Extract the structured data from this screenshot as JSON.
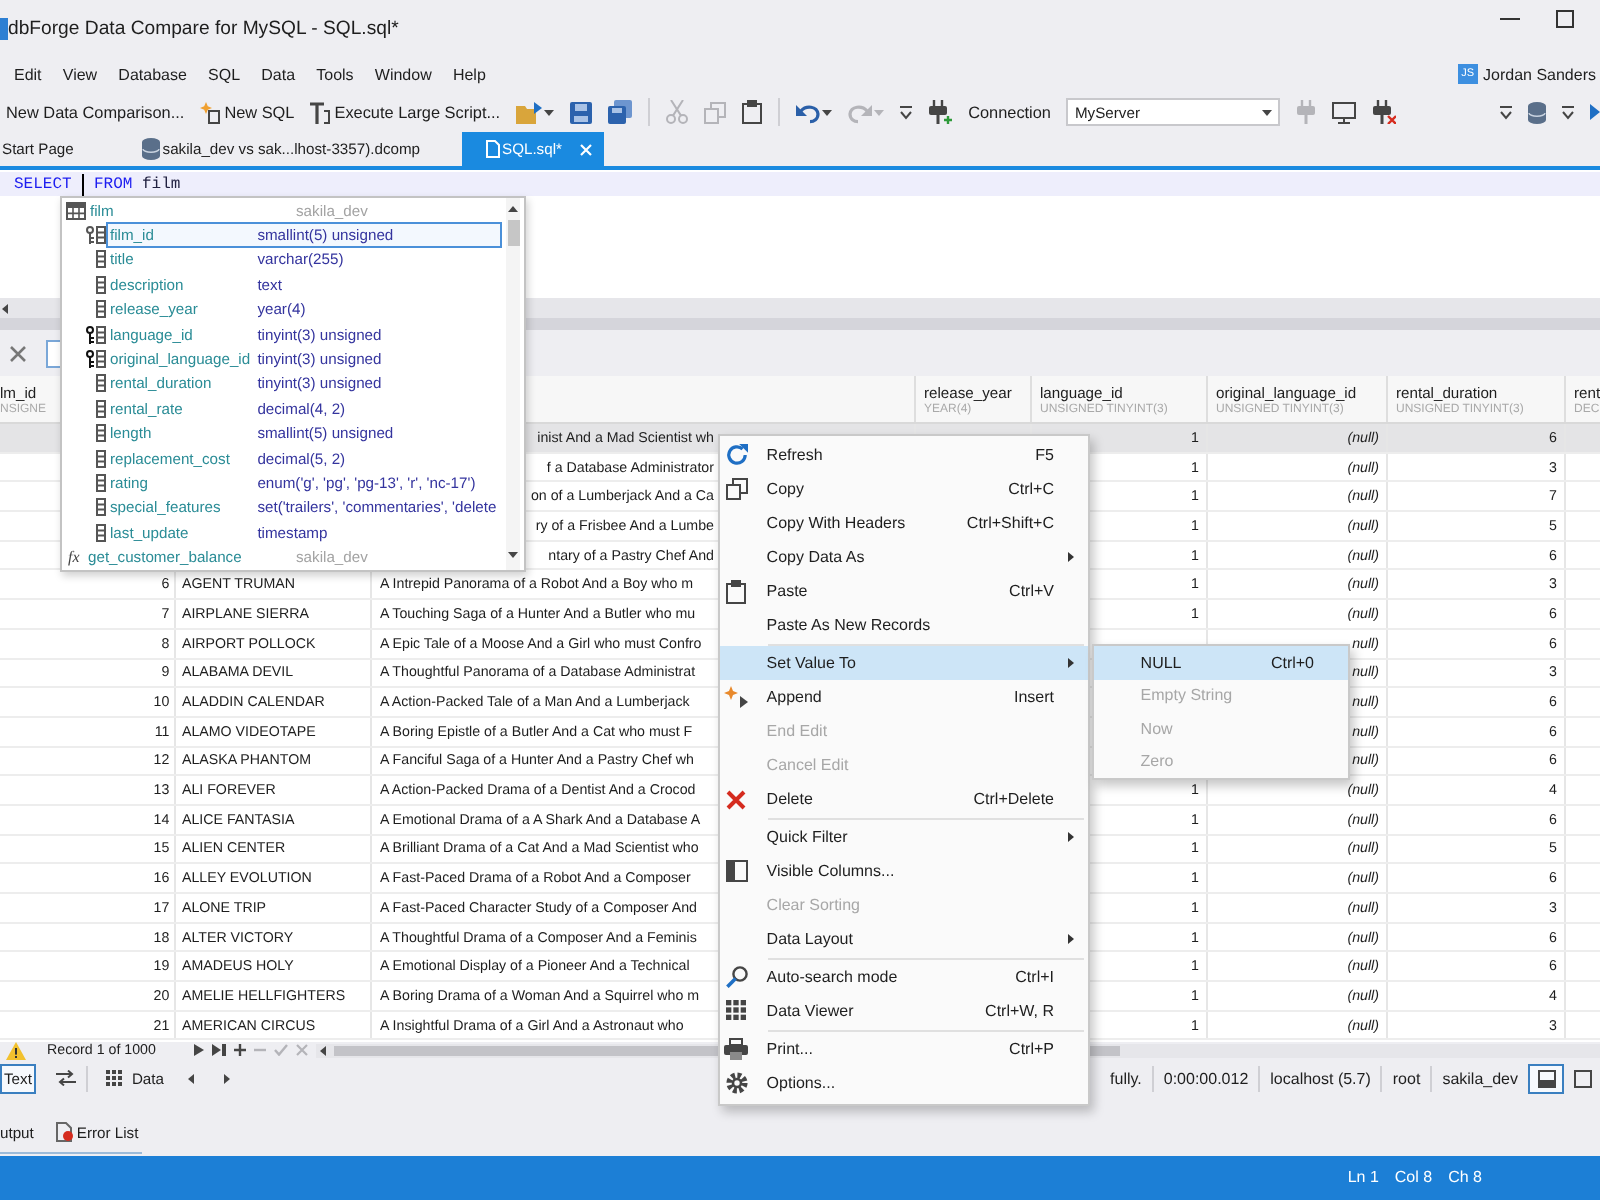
{
  "window": {
    "title": "dbForge Data Compare for MySQL - SQL.sql*"
  },
  "menu_bar": {
    "items": [
      "Edit",
      "View",
      "Database",
      "SQL",
      "Data",
      "Tools",
      "Window",
      "Help"
    ],
    "user": {
      "initials": "JS",
      "name": "Jordan Sanders"
    }
  },
  "toolbar": {
    "buttons": [
      "New Data Comparison...",
      "New SQL",
      "Execute Large Script..."
    ],
    "tools": [
      {
        "disabled": false
      },
      {
        "disabled": false
      },
      {
        "disabled": false
      },
      {
        "disabled": true
      },
      {
        "disabled": true
      },
      {
        "disabled": false
      },
      {
        "disabled": false
      },
      {
        "disabled": true
      }
    ],
    "connection": {
      "label": "Connection",
      "value": "MyServer"
    },
    "connection_tools": [
      {
        "disabled": false
      },
      {
        "disabled": true
      },
      {
        "disabled": false
      },
      {
        "disabled": false
      }
    ]
  },
  "document_tabs": [
    {
      "label": "Start Page",
      "selected": false
    },
    {
      "label": "sakila_dev vs sak...lhost-3357).dcomp",
      "selected": false
    },
    {
      "label": "SQL.sql*",
      "selected": true
    }
  ],
  "editor": {
    "tokens": [
      {
        "kind": "keyword",
        "text": "SELECT"
      },
      {
        "kind": "caret"
      },
      {
        "kind": "keyword",
        "text": "FROM"
      },
      {
        "kind": "identifier",
        "text": "film"
      }
    ]
  },
  "autocomplete": {
    "table": "film",
    "schema": "sakila_dev",
    "items": [
      {
        "kind": "primary_key",
        "name": "film_id",
        "detail": "smallint(5) unsigned",
        "selected": true
      },
      {
        "kind": "column",
        "name": "title",
        "detail": "varchar(255)",
        "selected": false
      },
      {
        "kind": "column",
        "name": "description",
        "detail": "text",
        "selected": false
      },
      {
        "kind": "column",
        "name": "release_year",
        "detail": "year(4)",
        "selected": false
      },
      {
        "kind": "foreign_key",
        "name": "language_id",
        "detail": "tinyint(3) unsigned",
        "selected": false
      },
      {
        "kind": "foreign_key",
        "name": "original_language_id",
        "detail": "tinyint(3) unsigned",
        "selected": false
      },
      {
        "kind": "column",
        "name": "rental_duration",
        "detail": "tinyint(3) unsigned",
        "selected": false
      },
      {
        "kind": "column",
        "name": "rental_rate",
        "detail": "decimal(4, 2)",
        "selected": false
      },
      {
        "kind": "column",
        "name": "length",
        "detail": "smallint(5) unsigned",
        "selected": false
      },
      {
        "kind": "column",
        "name": "replacement_cost",
        "detail": "decimal(5, 2)",
        "selected": false
      },
      {
        "kind": "column",
        "name": "rating",
        "detail": "enum('g', 'pg', 'pg-13', 'r', 'nc-17')",
        "selected": false
      },
      {
        "kind": "column",
        "name": "special_features",
        "detail": "set('trailers', 'commentaries', 'delete",
        "selected": false
      },
      {
        "kind": "column",
        "name": "last_update",
        "detail": "timestamp",
        "selected": false
      },
      {
        "kind": "function",
        "symbol": "fx",
        "name": "get_customer_balance",
        "detail": "sakila_dev",
        "selected": false
      }
    ]
  },
  "grid": {
    "columns": {
      "column_1": {
        "name": "lm_id",
        "type": "NSIGNE"
      },
      "column_4": {
        "name": "release_year",
        "type": "YEAR(4)"
      },
      "column_5": {
        "name": "language_id",
        "type": "UNSIGNED TINYINT(3)"
      },
      "column_6": {
        "name": "original_language_id",
        "type": "UNSIGNED TINYINT(3)"
      },
      "column_7": {
        "name": "rental_duration",
        "type": "UNSIGNED TINYINT(3)"
      },
      "column_8": {
        "name": "rent",
        "type": "DEC"
      }
    },
    "rows": [
      {
        "selected": true,
        "column_3": "inist And a Mad Scientist wh",
        "column_5": "1",
        "column_6": "(null)",
        "column_7": "6"
      },
      {
        "selected": false,
        "column_3": "f a Database Administrator",
        "column_5": "1",
        "column_6": "(null)",
        "column_7": "3"
      },
      {
        "selected": false,
        "column_3": "on of a Lumberjack And a Ca",
        "column_5": "1",
        "column_6": "(null)",
        "column_7": "7"
      },
      {
        "selected": false,
        "column_3": "ry of a Frisbee And a Lumbe",
        "column_5": "1",
        "column_6": "(null)",
        "column_7": "5"
      },
      {
        "selected": false,
        "column_3": "ntary of a Pastry Chef And",
        "column_5": "1",
        "column_6": "(null)",
        "column_7": "6"
      },
      {
        "selected": false,
        "column_1": "6",
        "column_2": "AGENT TRUMAN",
        "column_3": "A Intrepid Panorama of a Robot And a Boy who m",
        "column_5": "1",
        "column_6": "(null)",
        "column_7": "3"
      },
      {
        "selected": false,
        "column_1": "7",
        "column_2": "AIRPLANE SIERRA",
        "column_3": "A Touching Saga of a Hunter And a Butler who mu",
        "column_5": "1",
        "column_6": "(null)",
        "column_7": "6"
      },
      {
        "selected": false,
        "column_1": "8",
        "column_2": "AIRPORT POLLOCK",
        "column_3": "A Epic Tale of a Moose And a Girl who must Confro",
        "column_6": "null)",
        "column_7": "6"
      },
      {
        "selected": false,
        "column_1": "9",
        "column_2": "ALABAMA DEVIL",
        "column_3": "A Thoughtful Panorama of a Database Administrat",
        "column_6": "null)",
        "column_7": "3"
      },
      {
        "selected": false,
        "column_1": "10",
        "column_2": "ALADDIN CALENDAR",
        "column_3": "A Action-Packed Tale of a Man And a Lumberjack",
        "column_6": "null)",
        "column_7": "6"
      },
      {
        "selected": false,
        "column_1": "11",
        "column_2": "ALAMO VIDEOTAPE",
        "column_3": "A Boring Epistle of a Butler And a Cat who must F",
        "column_6": "null)",
        "column_7": "6"
      },
      {
        "selected": false,
        "column_1": "12",
        "column_2": "ALASKA PHANTOM",
        "column_3": "A Fanciful Saga of a Hunter And a Pastry Chef wh",
        "column_6": "null)",
        "column_7": "6"
      },
      {
        "selected": false,
        "column_1": "13",
        "column_2": "ALI FOREVER",
        "column_3": "A Action-Packed Drama of a Dentist And a Crocod",
        "column_5": "1",
        "column_6": "(null)",
        "column_7": "4"
      },
      {
        "selected": false,
        "column_1": "14",
        "column_2": "ALICE FANTASIA",
        "column_3": "A Emotional Drama of a A Shark And a Database A",
        "column_5": "1",
        "column_6": "(null)",
        "column_7": "6"
      },
      {
        "selected": false,
        "column_1": "15",
        "column_2": "ALIEN CENTER",
        "column_3": "A Brilliant Drama of a Cat And a Mad Scientist who",
        "column_5": "1",
        "column_6": "(null)",
        "column_7": "5"
      },
      {
        "selected": false,
        "column_1": "16",
        "column_2": "ALLEY EVOLUTION",
        "column_3": "A Fast-Paced Drama of a Robot And a Composer",
        "column_5": "1",
        "column_6": "(null)",
        "column_7": "6"
      },
      {
        "selected": false,
        "column_1": "17",
        "column_2": "ALONE TRIP",
        "column_3": "A Fast-Paced Character Study of a Composer And",
        "column_5": "1",
        "column_6": "(null)",
        "column_7": "3"
      },
      {
        "selected": false,
        "column_1": "18",
        "column_2": "ALTER VICTORY",
        "column_3": "A Thoughtful Drama of a Composer And a Feminis",
        "column_5": "1",
        "column_6": "(null)",
        "column_7": "6"
      },
      {
        "selected": false,
        "column_1": "19",
        "column_2": "AMADEUS HOLY",
        "column_3": "A Emotional Display of a Pioneer And a Technical",
        "column_5": "1",
        "column_6": "(null)",
        "column_7": "6"
      },
      {
        "selected": false,
        "column_1": "20",
        "column_2": "AMELIE HELLFIGHTERS",
        "column_3": "A Boring Drama of a Woman And a Squirrel who m",
        "column_5": "1",
        "column_6": "(null)",
        "column_7": "4"
      },
      {
        "selected": false,
        "column_1": "21",
        "column_2": "AMERICAN CIRCUS",
        "column_3": "A Insightful Drama of a Girl And a Astronaut who",
        "column_5": "1",
        "column_6": "(null)",
        "column_7": "3"
      }
    ],
    "record": "Record 1 of 1000",
    "navigator": [
      {
        "disabled": false
      },
      {
        "disabled": false
      },
      {
        "disabled": false
      },
      {
        "disabled": true
      },
      {
        "disabled": true
      },
      {
        "disabled": true
      }
    ]
  },
  "bottom_toolbar": {
    "views": [
      {
        "label": "Text",
        "selected": true
      },
      {
        "label": "Data",
        "selected": false
      }
    ],
    "status": [
      "fully.",
      "0:00:00.012",
      "localhost (5.7)",
      "root",
      "sakila_dev"
    ],
    "layouts": [
      {
        "selected": true
      },
      {
        "selected": false
      }
    ]
  },
  "panel_tabs": [
    "utput",
    "Error List"
  ],
  "status_bar": [
    "Ln 1",
    "Col 8",
    "Ch 8"
  ],
  "context_menu": {
    "sections": [
      [
        {
          "label": "Refresh",
          "shortcut": "F5",
          "disabled": false,
          "selected": false,
          "submenu": false
        },
        {
          "label": "Copy",
          "shortcut": "Ctrl+C",
          "disabled": false,
          "selected": false,
          "submenu": false
        },
        {
          "label": "Copy With Headers",
          "shortcut": "Ctrl+Shift+C",
          "disabled": false,
          "selected": false,
          "submenu": false
        },
        {
          "label": "Copy Data As",
          "disabled": false,
          "selected": false,
          "submenu": true
        },
        {
          "label": "Paste",
          "shortcut": "Ctrl+V",
          "disabled": false,
          "selected": false,
          "submenu": false
        },
        {
          "label": "Paste As New Records",
          "disabled": false,
          "selected": false,
          "submenu": false
        }
      ],
      [
        {
          "label": "Set Value To",
          "disabled": false,
          "selected": true,
          "submenu": true
        },
        {
          "label": "Append",
          "shortcut": "Insert",
          "disabled": false,
          "selected": false,
          "submenu": false
        },
        {
          "label": "End Edit",
          "disabled": true,
          "selected": false,
          "submenu": false
        },
        {
          "label": "Cancel Edit",
          "disabled": true,
          "selected": false,
          "submenu": false
        },
        {
          "label": "Delete",
          "shortcut": "Ctrl+Delete",
          "disabled": false,
          "selected": false,
          "submenu": false
        }
      ],
      [
        {
          "label": "Quick Filter",
          "disabled": false,
          "selected": false,
          "submenu": true
        },
        {
          "label": "Visible Columns...",
          "disabled": false,
          "selected": false,
          "submenu": false
        },
        {
          "label": "Clear Sorting",
          "disabled": true,
          "selected": false,
          "submenu": false
        },
        {
          "label": "Data Layout",
          "disabled": false,
          "selected": false,
          "submenu": true
        }
      ],
      [
        {
          "label": "Auto-search mode",
          "shortcut": "Ctrl+I",
          "disabled": false,
          "selected": false,
          "submenu": false
        },
        {
          "label": "Data Viewer",
          "shortcut": "Ctrl+W, R",
          "disabled": false,
          "selected": false,
          "submenu": false
        }
      ],
      [
        {
          "label": "Print...",
          "shortcut": "Ctrl+P",
          "disabled": false,
          "selected": false,
          "submenu": false
        },
        {
          "label": "Options...",
          "disabled": false,
          "selected": false,
          "submenu": false
        }
      ]
    ]
  },
  "submenu": {
    "items": [
      {
        "label": "NULL",
        "shortcut": "Ctrl+0",
        "disabled": false,
        "selected": true,
        "submenu": false
      },
      {
        "label": "Empty String",
        "disabled": true,
        "selected": false,
        "submenu": false
      },
      {
        "label": "Now",
        "disabled": true,
        "selected": false,
        "submenu": false
      },
      {
        "label": "Zero",
        "disabled": true,
        "selected": false,
        "submenu": false
      }
    ]
  }
}
